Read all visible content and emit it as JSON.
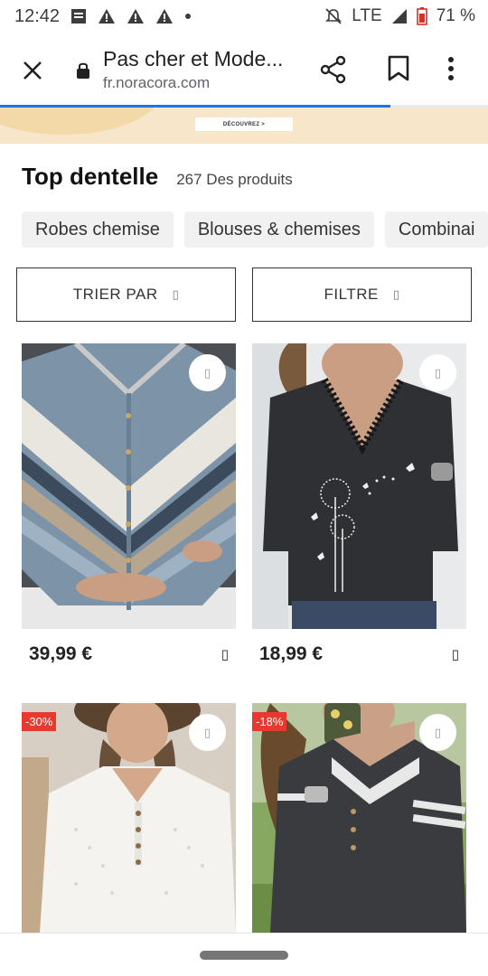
{
  "status_bar": {
    "time": "12:42",
    "network": "LTE",
    "battery": "71 %"
  },
  "browser": {
    "page_title": "Pas cher et Mode...",
    "url": "fr.noracora.com",
    "load_progress": 0.8
  },
  "banner": {
    "cta_label": "DÉCOUVREZ >"
  },
  "section": {
    "title": "Top dentelle",
    "count": "267 Des produits"
  },
  "chips": [
    {
      "label": "Robes chemise"
    },
    {
      "label": "Blouses & chemises"
    },
    {
      "label": "Combinai"
    }
  ],
  "sort": {
    "sort_label": "TRIER PAR",
    "filter_label": "FILTRE",
    "caret": "▯"
  },
  "products": [
    {
      "price": "39,99 €",
      "discount": "",
      "bag_icon": "▯",
      "wish_icon": "▯"
    },
    {
      "price": "18,99 €",
      "discount": "",
      "bag_icon": "▯",
      "wish_icon": "▯"
    },
    {
      "price": "",
      "discount": "-30%",
      "bag_icon": "",
      "wish_icon": "▯"
    },
    {
      "price": "",
      "discount": "-18%",
      "bag_icon": "",
      "wish_icon": "▯"
    }
  ],
  "icons": {
    "close": "close-icon",
    "lock": "lock-icon",
    "share": "share-icon",
    "bookmark": "bookmark-icon",
    "menu": "more-vert-icon"
  },
  "colors": {
    "accent": "#1a73e8",
    "discount": "#e8392f"
  }
}
